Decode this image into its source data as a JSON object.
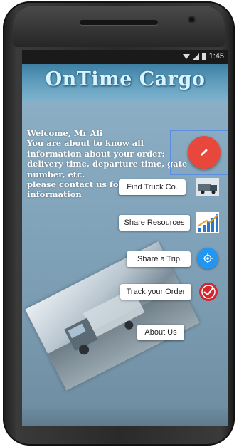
{
  "status_bar": {
    "time": "1:45"
  },
  "header": {
    "title": "OnTime Cargo"
  },
  "welcome": {
    "lines": [
      "Welcome, Mr Ali",
      "You are about to know all",
      "information about your order:",
      "delivery time, departure time, gate",
      "number, etc.",
      "please contact us for any",
      "information"
    ]
  },
  "menu": {
    "find_truck": "Find Truck Co.",
    "share_resources": "Share Resources",
    "share_trip": "Share a Trip",
    "track_order": "Track your Order",
    "about_us": "About Us"
  },
  "icons": {
    "fab": "pencil-icon",
    "find_truck": "truck-icon",
    "share_resources": "bar-chart-icon",
    "share_trip": "location-icon",
    "track_order": "tracking-icon"
  },
  "colors": {
    "fab": "#e8483c",
    "location_fab": "#2196f3",
    "title": "#d9f3ff"
  }
}
